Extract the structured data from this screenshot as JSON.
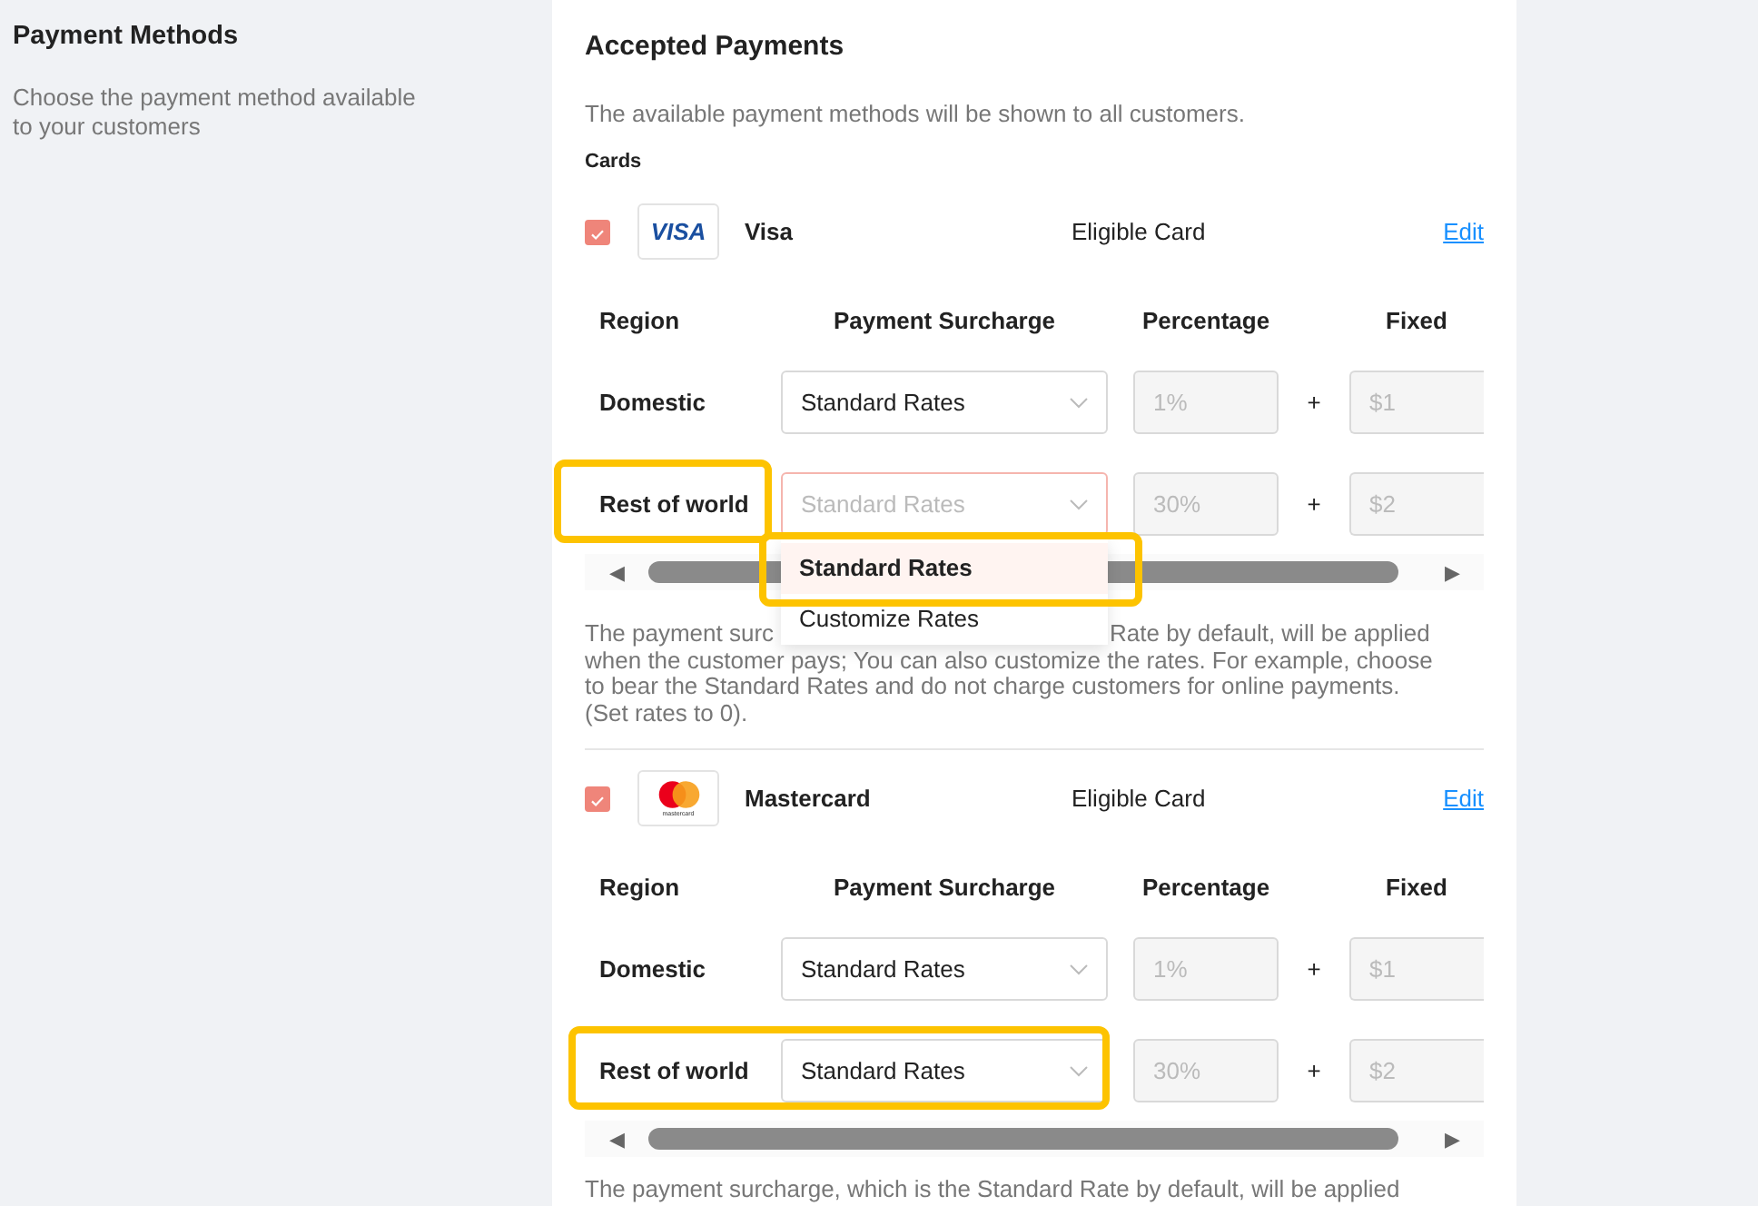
{
  "sidebar": {
    "title": "Payment Methods",
    "description": "Choose the payment method available to your customers"
  },
  "panel": {
    "title": "Accepted Payments",
    "description": "The available payment methods will be shown to all customers.",
    "section": "Cards",
    "cards": [
      {
        "kind": "visa",
        "logo_text": "VISA",
        "name": "Visa",
        "checked": true,
        "type": "Eligible Card",
        "edit": "Edit",
        "columns": [
          "Region",
          "Payment Surcharge",
          "Percentage",
          "Fixed"
        ],
        "rows": [
          {
            "region": "Domestic",
            "surcharge": "Standard Rates",
            "open": false,
            "percentage": "1%",
            "plus": "+",
            "fixed": "$1",
            "highlight_region": false,
            "highlight_select": false
          },
          {
            "region": "Rest of world",
            "surcharge": "Standard Rates",
            "open": true,
            "options": [
              {
                "label": "Standard Rates",
                "selected": true,
                "highlighted": true
              },
              {
                "label": "Customize Rates",
                "selected": false,
                "highlighted": false
              }
            ],
            "percentage": "30%",
            "plus": "+",
            "fixed": "$2",
            "highlight_region": true,
            "highlight_select": false
          }
        ],
        "scroll_left": "◀",
        "scroll_right": "▶",
        "note": [
          [
            "The payment surc",
            "Rate by default, will be applied"
          ],
          [
            "when the customer pays; You can also customize the rates. For example, choose"
          ],
          [
            "to bear the Standard Rates and do not charge customers for online payments."
          ],
          [
            "(Set rates to 0)."
          ]
        ]
      },
      {
        "kind": "mastercard",
        "logo_text": "mastercard",
        "name": "Mastercard",
        "checked": true,
        "type": "Eligible Card",
        "edit": "Edit",
        "columns": [
          "Region",
          "Payment Surcharge",
          "Percentage",
          "Fixed"
        ],
        "rows": [
          {
            "region": "Domestic",
            "surcharge": "Standard Rates",
            "open": false,
            "percentage": "1%",
            "plus": "+",
            "fixed": "$1",
            "highlight_region": false,
            "highlight_select": false
          },
          {
            "region": "Rest of world",
            "surcharge": "Standard Rates",
            "open": false,
            "percentage": "30%",
            "plus": "+",
            "fixed": "$2",
            "highlight_region": true,
            "highlight_select": true
          }
        ],
        "scroll_left": "◀",
        "scroll_right": "▶",
        "note": [
          [
            "The payment surcharge, which is the Standard Rate by default, will be applied"
          ]
        ]
      }
    ]
  }
}
